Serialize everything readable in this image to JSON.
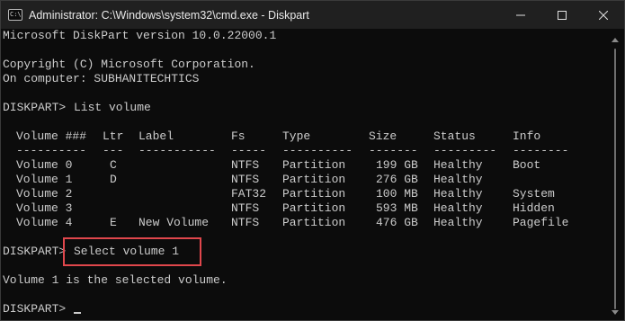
{
  "window": {
    "title": "Administrator: C:\\Windows\\system32\\cmd.exe - Diskpart",
    "icon_glyph": "C:\\",
    "controls": {
      "minimize": "minimize-icon",
      "maximize": "maximize-icon",
      "close": "close-icon"
    }
  },
  "console": {
    "version_line": "Microsoft DiskPart version 10.0.22000.1",
    "copyright_line": "Copyright (C) Microsoft Corporation.",
    "computer_line": "On computer: SUBHANITECHTICS",
    "prompt": "DISKPART>",
    "command_list": "List volume",
    "table": {
      "headers": [
        "Volume ###",
        "Ltr",
        "Label",
        "Fs",
        "Type",
        "Size",
        "Status",
        "Info"
      ],
      "separators": [
        "----------",
        "---",
        "-----------",
        "-----",
        "----------",
        "-------",
        "---------",
        "--------"
      ],
      "rows": [
        [
          "Volume 0",
          "C",
          "",
          "NTFS",
          "Partition",
          "199 GB",
          "Healthy",
          "Boot"
        ],
        [
          "Volume 1",
          "D",
          "",
          "NTFS",
          "Partition",
          "276 GB",
          "Healthy",
          ""
        ],
        [
          "Volume 2",
          "",
          "",
          "FAT32",
          "Partition",
          "100 MB",
          "Healthy",
          "System"
        ],
        [
          "Volume 3",
          "",
          "",
          "NTFS",
          "Partition",
          "593 MB",
          "Healthy",
          "Hidden"
        ],
        [
          "Volume 4",
          "E",
          "New Volume",
          "NTFS",
          "Partition",
          "476 GB",
          "Healthy",
          "Pagefile"
        ]
      ]
    },
    "command_select": "Select volume 1",
    "result_line": "Volume 1 is the selected volume.",
    "highlight_color": "#e0474c",
    "text_color": "#cccccc",
    "background_color": "#0c0c0c"
  }
}
